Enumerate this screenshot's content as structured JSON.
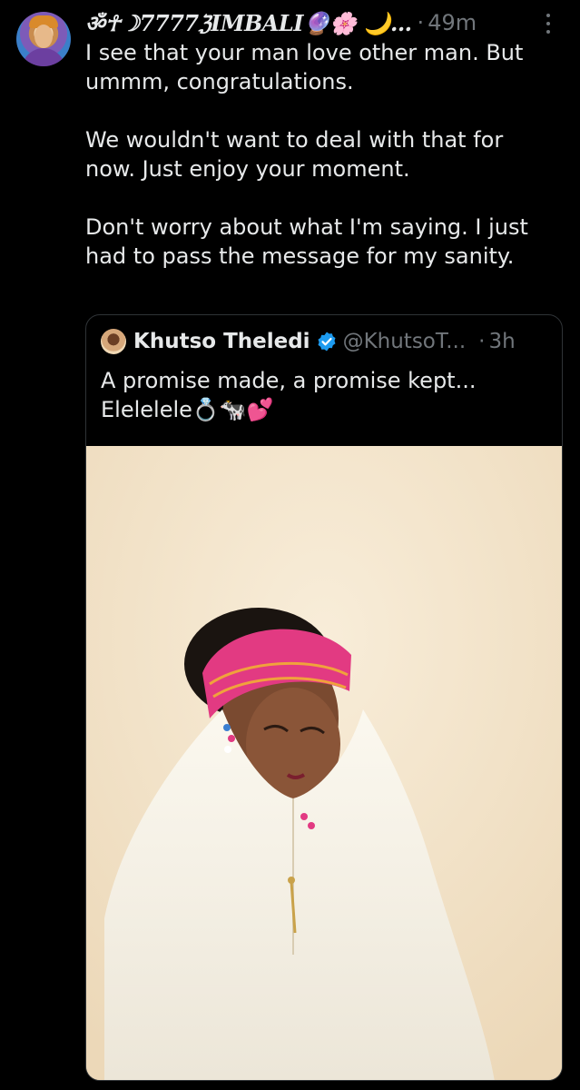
{
  "post": {
    "author_display_name": "ॐ☥☽7777ℨIMBALI🔮🌸 🌙...",
    "separator": "·",
    "timestamp": "49m",
    "more_icon": "more-vertical-icon",
    "text_paragraphs": [
      "I see that your man love other man. But ummm, congratulations.",
      "We wouldn't want to deal with that for now. Just enjoy your moment.",
      "Don't worry about what I'm saying. I just had to pass the message for my sanity."
    ]
  },
  "quoted": {
    "author_name": "Khutso Theledi",
    "verified_icon": "verified-badge-icon",
    "handle": "@KhutsoT...",
    "separator": "·",
    "timestamp": "3h",
    "text_lines": [
      "A promise made, a promise kept...",
      "Elelelele💍🐄💕"
    ],
    "media": "photo"
  },
  "colors": {
    "background": "#000000",
    "text_primary": "#e7e9ea",
    "text_secondary": "#71767b",
    "border": "#2f3336",
    "verified_blue": "#1d9bf0"
  }
}
